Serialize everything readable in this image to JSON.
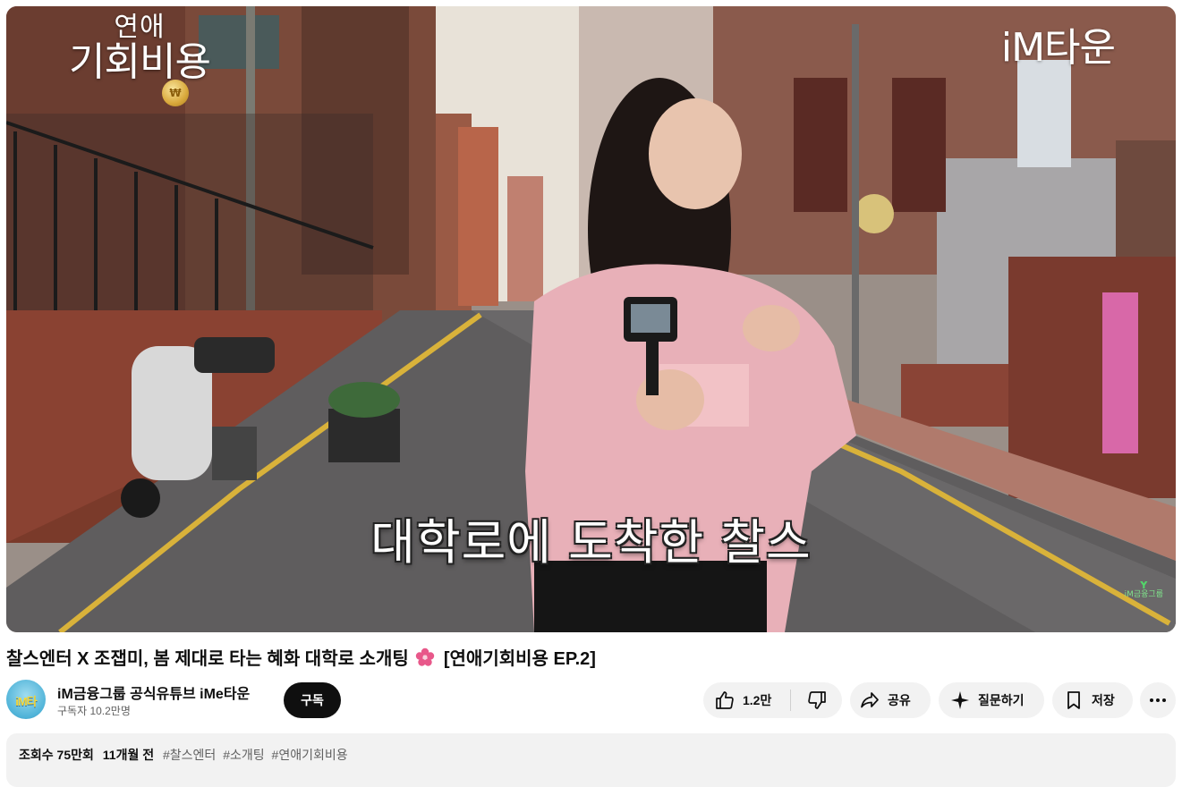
{
  "player": {
    "show_logo_line1": "연애",
    "show_logo_line2": "기회비용",
    "channel_watermark": "iM타운",
    "subtitle": "대학로에 도착한 찰스",
    "corner_bug_text": "iM금융그룹"
  },
  "video": {
    "title": "찰스엔터 X 조잽미, 봄 제대로 타는 혜화 대학로 소개팅",
    "title_suffix": "[연애기회비용 EP.2]"
  },
  "channel": {
    "name": "iM금융그룹 공식유튜브 iMe타운",
    "subscribers": "구독자 10.2만명",
    "subscribe_label": "구독"
  },
  "actions": {
    "like_count": "1.2만",
    "share_label": "공유",
    "ask_label": "질문하기",
    "save_label": "저장"
  },
  "description": {
    "views": "조회수 75만회",
    "age": "11개월 전",
    "hashtags": [
      "#찰스엔터",
      "#소개팅",
      "#연애기회비용"
    ]
  },
  "icons": {
    "like": "thumbs-up-icon",
    "dislike": "thumbs-down-icon",
    "share": "share-arrow-icon",
    "ask": "sparkle-icon",
    "save": "bookmark-icon",
    "more": "more-horizontal-icon"
  },
  "colors": {
    "subscribe_bg": "#0f0f0f",
    "pill_bg": "#f2f2f2",
    "flower": "#e8588a"
  }
}
